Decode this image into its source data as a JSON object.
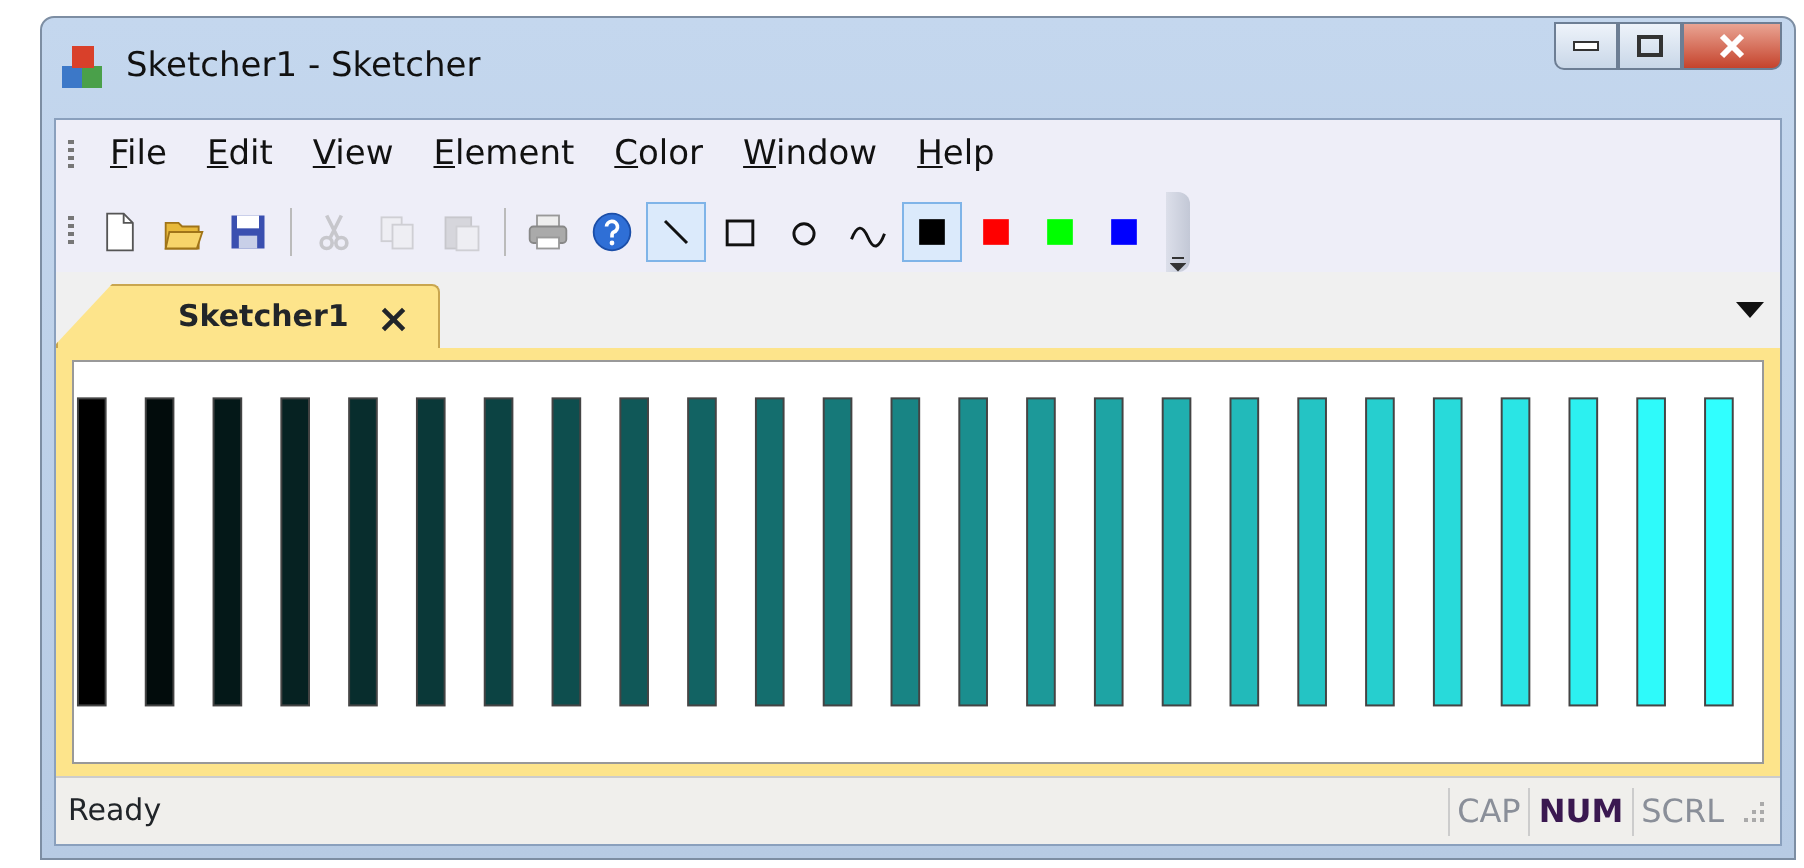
{
  "window": {
    "title": "Sketcher1 - Sketcher"
  },
  "menu": [
    {
      "label": "File"
    },
    {
      "label": "Edit"
    },
    {
      "label": "View"
    },
    {
      "label": "Element"
    },
    {
      "label": "Color"
    },
    {
      "label": "Window"
    },
    {
      "label": "Help"
    }
  ],
  "toolbar": [
    {
      "kind": "new",
      "disabled": false
    },
    {
      "kind": "open",
      "disabled": false
    },
    {
      "kind": "save",
      "disabled": false
    },
    {
      "kind": "sep"
    },
    {
      "kind": "cut",
      "disabled": true
    },
    {
      "kind": "copy",
      "disabled": true
    },
    {
      "kind": "paste",
      "disabled": true
    },
    {
      "kind": "sep"
    },
    {
      "kind": "print",
      "disabled": false
    },
    {
      "kind": "help",
      "disabled": false
    },
    {
      "kind": "line",
      "selected": true
    },
    {
      "kind": "rect",
      "selected": false
    },
    {
      "kind": "circle",
      "selected": false
    },
    {
      "kind": "curve",
      "selected": false
    },
    {
      "kind": "color",
      "color": "#000000",
      "selected": true
    },
    {
      "kind": "color",
      "color": "#ff0000",
      "selected": false
    },
    {
      "kind": "color",
      "color": "#00ff00",
      "selected": false
    },
    {
      "kind": "color",
      "color": "#0000ff",
      "selected": false
    }
  ],
  "tabs": [
    {
      "label": "Sketcher1",
      "selected": true,
      "close": "×"
    }
  ],
  "sketch": {
    "bars": [
      {
        "color": "#000000"
      },
      {
        "color": "#020c0c"
      },
      {
        "color": "#041818"
      },
      {
        "color": "#062222"
      },
      {
        "color": "#082d2d"
      },
      {
        "color": "#0a3838"
      },
      {
        "color": "#0c4343"
      },
      {
        "color": "#0e4e4e"
      },
      {
        "color": "#105858"
      },
      {
        "color": "#126363"
      },
      {
        "color": "#146e6e"
      },
      {
        "color": "#167979"
      },
      {
        "color": "#188484"
      },
      {
        "color": "#1a8e8e"
      },
      {
        "color": "#1c9999"
      },
      {
        "color": "#1ea4a4"
      },
      {
        "color": "#20afaf"
      },
      {
        "color": "#22baba"
      },
      {
        "color": "#24c4c4"
      },
      {
        "color": "#26cfcf"
      },
      {
        "color": "#28dada"
      },
      {
        "color": "#2ae5e5"
      },
      {
        "color": "#2cf0f0"
      },
      {
        "color": "#2efafa"
      },
      {
        "color": "#30ffff"
      }
    ]
  },
  "status_bar": {
    "text": "Ready",
    "indicators": [
      {
        "label": "CAP",
        "on": false
      },
      {
        "label": "NUM",
        "on": true
      },
      {
        "label": "SCRL",
        "on": false
      }
    ]
  }
}
